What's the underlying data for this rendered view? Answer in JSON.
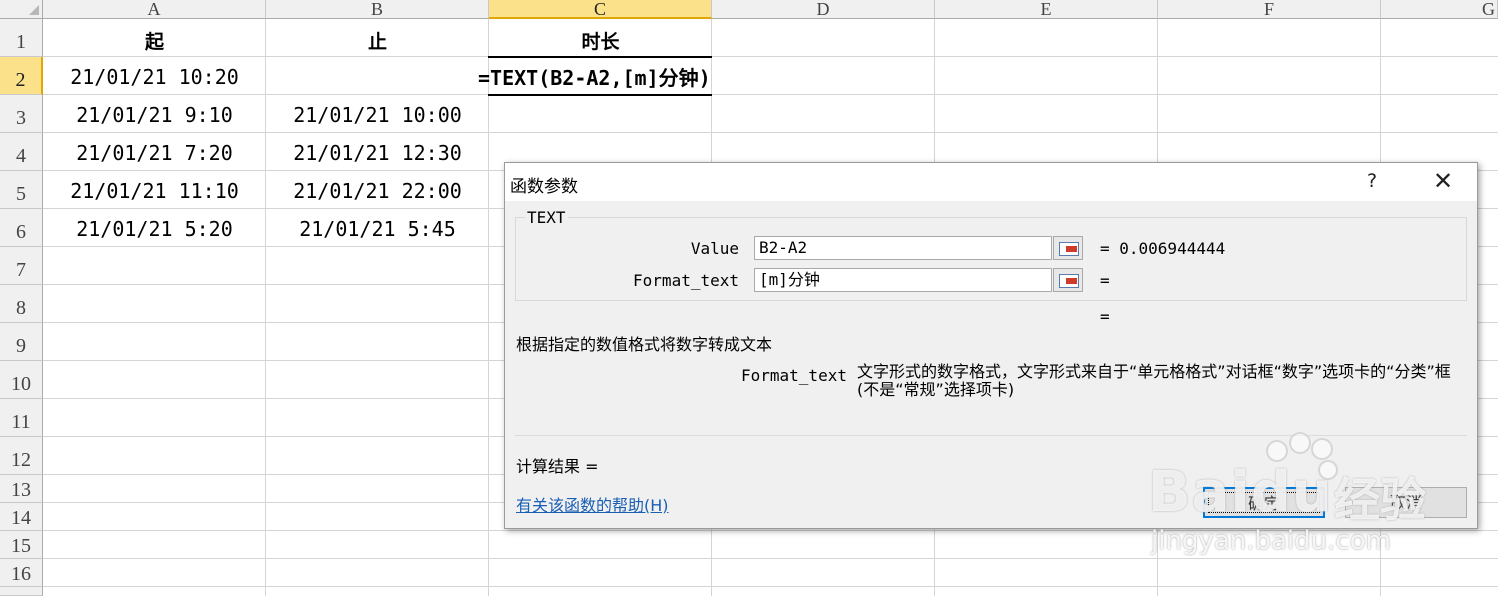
{
  "columns": [
    "A",
    "B",
    "C",
    "D",
    "E",
    "F",
    "G"
  ],
  "rows": [
    "1",
    "2",
    "3",
    "4",
    "5",
    "6",
    "7",
    "8",
    "9",
    "10",
    "11",
    "12",
    "13",
    "14",
    "15",
    "16"
  ],
  "cells": {
    "A1": "起",
    "B1": "止",
    "C1": "时长",
    "A2": "21/01/21 10:20",
    "B2": "",
    "C2": "=TEXT(B2-A2,[m]分钟)",
    "A3": "21/01/21 9:10",
    "B3": "21/01/21 10:00",
    "A4": "21/01/21 7:20",
    "B4": "21/01/21 12:30",
    "A5": "21/01/21 11:10",
    "B5": "21/01/21 22:00",
    "A6": "21/01/21 5:20",
    "B6": "21/01/21 5:45"
  },
  "dialog": {
    "title": "函数参数",
    "help_glyph": "?",
    "close_glyph": "✕",
    "function_name": "TEXT",
    "args": [
      {
        "label": "Value",
        "value": "B2-A2",
        "result": "= 0.006944444"
      },
      {
        "label": "Format_text",
        "value": "[m]分钟",
        "result": "="
      }
    ],
    "overall_eq": "=",
    "description": "根据指定的数值格式将数字转成文本",
    "arg_desc_name": "Format_text",
    "arg_desc_text": "文字形式的数字格式，文字形式来自于“单元格格式”对话框“数字”选项卡的“分类”框(不是“常规”选择项卡)",
    "calc_result": "计算结果 =",
    "help_link": "有关该函数的帮助(H)",
    "ok_label": "确定",
    "cancel_label": "取消"
  },
  "watermark": {
    "brand": "Baidu",
    "product": "经验",
    "url": "jingyan.baidu.com"
  }
}
